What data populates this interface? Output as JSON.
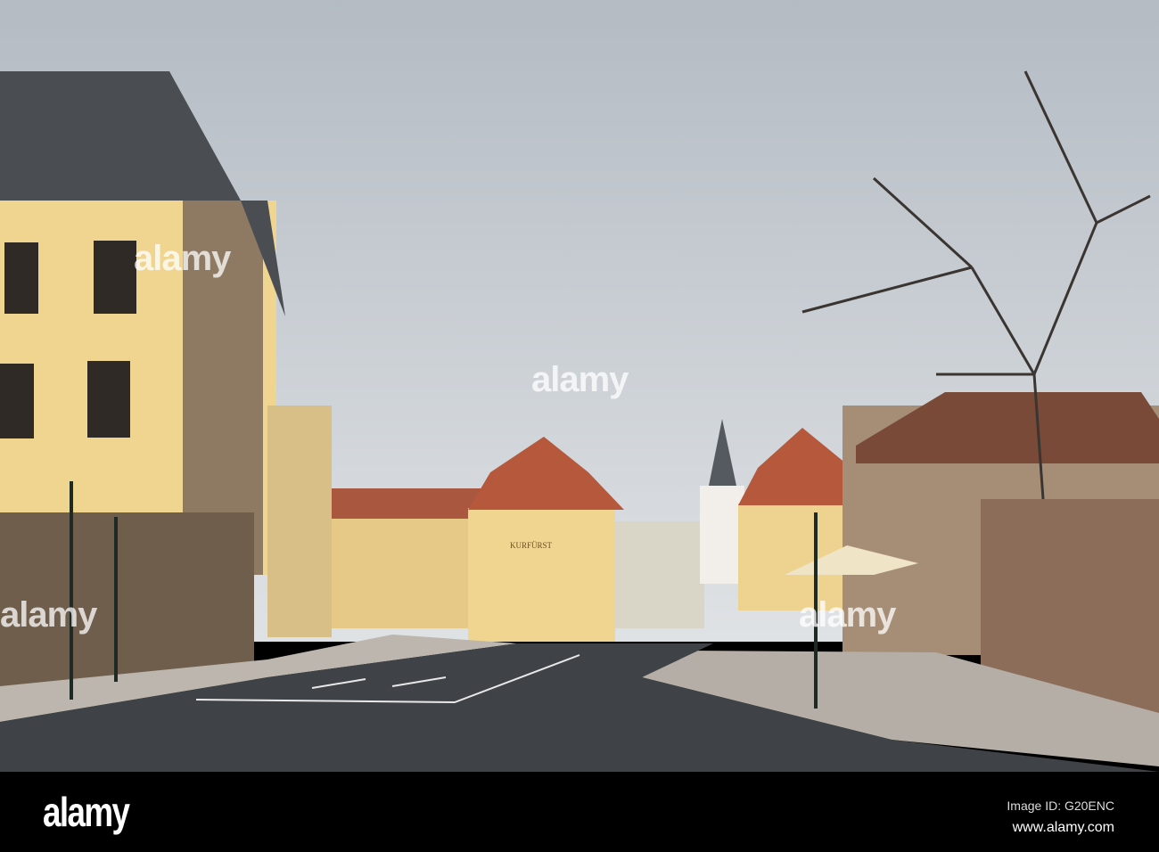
{
  "photo": {
    "sign_text": "KURFÜRST",
    "watermark": "alamy"
  },
  "footer": {
    "logo": "alamy",
    "image_id": "Image ID: G20ENC",
    "url": "www.alamy.com"
  },
  "colors": {
    "sky": "#c9ced4",
    "road": "#3f4347",
    "facade": "#f0d591",
    "roof": "#4a4d52",
    "tile_roof": "#b5583c"
  }
}
